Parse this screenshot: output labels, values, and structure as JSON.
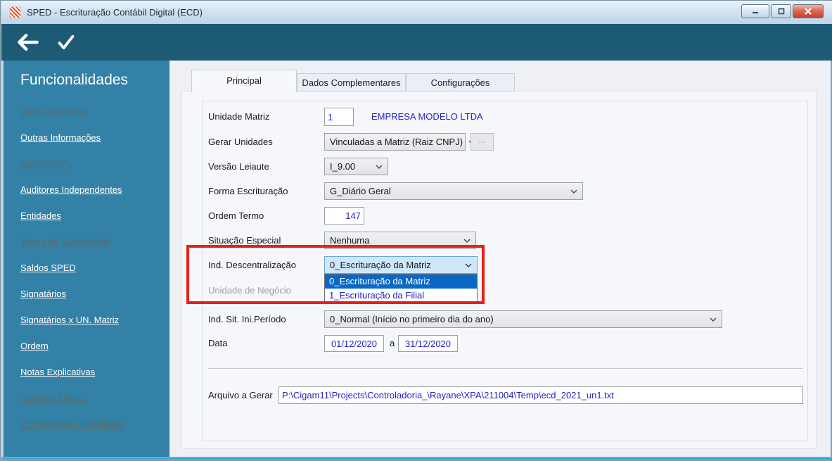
{
  "window": {
    "title": "SPED - Escrituração Contábil Digital (ECD)"
  },
  "sidebar": {
    "title": "Funcionalidades",
    "items": [
      {
        "label": "Livros Auxiliares",
        "enabled": false
      },
      {
        "label": "Outras Informações",
        "enabled": true
      },
      {
        "label": "DLPA/DMPL",
        "enabled": false
      },
      {
        "label": "Auditores Independentes",
        "enabled": true
      },
      {
        "label": "Entidades",
        "enabled": true
      },
      {
        "label": "Termo de Substituição",
        "enabled": false
      },
      {
        "label": "Saldos SPED",
        "enabled": true
      },
      {
        "label": "Signatários",
        "enabled": true
      },
      {
        "label": "Signatários x UN. Matriz",
        "enabled": true
      },
      {
        "label": "Ordem",
        "enabled": true
      },
      {
        "label": "Notas Explicativas",
        "enabled": true
      },
      {
        "label": "Contas x UNEG",
        "enabled": false
      },
      {
        "label": "I355 sem Mov. Resultado",
        "enabled": false
      }
    ]
  },
  "tabs": [
    {
      "label": "Principal",
      "active": true
    },
    {
      "label": "Dados Complementares",
      "active": false
    },
    {
      "label": "Configurações",
      "active": false
    }
  ],
  "form": {
    "unidade_matriz": {
      "label": "Unidade Matriz",
      "value": "1",
      "company": "EMPRESA MODELO LTDA"
    },
    "gerar_unidades": {
      "label": "Gerar Unidades",
      "value": "Vinculadas a Matriz (Raiz CNPJ)",
      "browse": "..."
    },
    "versao_leiaute": {
      "label": "Versão Leiaute",
      "value": "I_9.00"
    },
    "forma_escrituracao": {
      "label": "Forma Escrituração",
      "value": "G_Diário Geral"
    },
    "ordem_termo": {
      "label": "Ordem Termo",
      "value": "147"
    },
    "situacao_especial": {
      "label": "Situação Especial",
      "value": "Nenhuma"
    },
    "ind_descentralizacao": {
      "label": "Ind. Descentralização",
      "value": "0_Escrituração da Matriz",
      "options": [
        "0_Escrituração da Matriz",
        "1_Escrituração da Filial"
      ]
    },
    "unidade_negocio": {
      "label": "Unidade de Negócio"
    },
    "ind_sit_ini_periodo": {
      "label": "Ind. Sit. Ini.Período",
      "value": "0_Normal (Início no primeiro dia do ano)"
    },
    "data": {
      "label": "Data",
      "from": "01/12/2020",
      "sep": "a",
      "to": "31/12/2020"
    },
    "arquivo_a_gerar": {
      "label": "Arquivo a Gerar",
      "value": "P:\\Cigam11\\Projects\\Controladoria_\\Rayane\\XPA\\211004\\Temp\\ecd_2021_un1.txt"
    }
  },
  "colors": {
    "toolbar_teal": "#1d5a74",
    "sidebar_teal": "#3381a6",
    "highlight_red": "#e62117",
    "selection_blue": "#0a68c4",
    "value_blue": "#2323cb"
  }
}
